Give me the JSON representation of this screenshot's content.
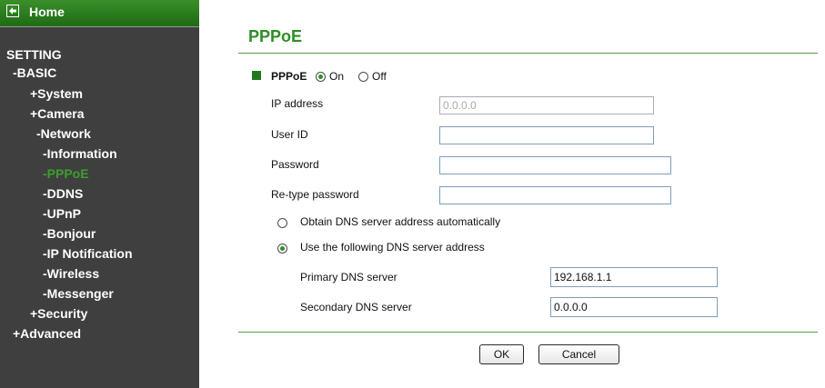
{
  "sidebar": {
    "home_label": "Home",
    "items": [
      {
        "label": "SETTING"
      },
      {
        "label": "-BASIC"
      },
      {
        "label": "+System"
      },
      {
        "label": "+Camera"
      },
      {
        "label": "-Network"
      },
      {
        "label": "-Information"
      },
      {
        "label": "-PPPoE"
      },
      {
        "label": "-DDNS"
      },
      {
        "label": "-UPnP"
      },
      {
        "label": "-Bonjour"
      },
      {
        "label": "-IP Notification"
      },
      {
        "label": "-Wireless"
      },
      {
        "label": "-Messenger"
      },
      {
        "label": "+Security"
      },
      {
        "label": "+Advanced"
      }
    ]
  },
  "main": {
    "title": "PPPoE",
    "pppoe_label": "PPPoE",
    "on_label": "On",
    "off_label": "Off",
    "pppoe_state": "On",
    "ip_label": "IP address",
    "ip_value": "0.0.0.0",
    "userid_label": "User ID",
    "userid_value": "",
    "password_label": "Password",
    "password_value": "",
    "retype_label": "Re-type password",
    "retype_value": "",
    "dns_auto_label": "Obtain DNS server address automatically",
    "dns_manual_label": "Use the following DNS server address",
    "dns_mode": "manual",
    "primary_label": "Primary DNS server",
    "primary_value": "192.168.1.1",
    "secondary_label": "Secondary DNS server",
    "secondary_value": "0.0.0.0",
    "ok_label": "OK",
    "cancel_label": "Cancel"
  },
  "colors": {
    "accent_green": "#2f8e24",
    "sidebar_bg": "#3f3f3f",
    "active_item": "#3aa02a"
  }
}
